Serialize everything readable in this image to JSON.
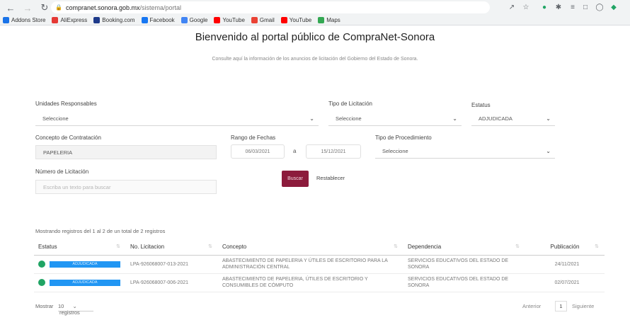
{
  "browser": {
    "url_domain": "compranet.sonora.gob.mx",
    "url_path": "/sistema/portal",
    "bookmarks": [
      {
        "label": "Addons Store",
        "color": "#1a73e8"
      },
      {
        "label": "AliExpress",
        "color": "#e53935"
      },
      {
        "label": "Booking.com",
        "color": "#1e3a8a"
      },
      {
        "label": "Facebook",
        "color": "#1877f2"
      },
      {
        "label": "Google",
        "color": "#4285f4"
      },
      {
        "label": "YouTube",
        "color": "#ff0000"
      },
      {
        "label": "Gmail",
        "color": "#ea4335"
      },
      {
        "label": "YouTube",
        "color": "#ff0000"
      },
      {
        "label": "Maps",
        "color": "#34a853"
      }
    ]
  },
  "page": {
    "title": "Bienvenido al portal público de CompraNet-Sonora",
    "subtitle": "Consulte aquí la información de los anuncios de licitación del Gobierno del Estado de Sonora."
  },
  "filters": {
    "unidades_label": "Unidades Responsables",
    "unidades_value": "Seleccione",
    "tipo_lic_label": "Tipo de Licitación",
    "tipo_lic_value": "Seleccione",
    "estatus_label": "Estatus",
    "estatus_value": "ADJUDICADA",
    "concepto_label": "Concepto de Contratación",
    "concepto_value": "PAPELERIA",
    "rango_label": "Rango de Fechas",
    "fecha_desde": "06/03/2021",
    "fecha_sep": "a",
    "fecha_hasta": "15/12/2021",
    "tipo_proc_label": "Tipo de Procedimiento",
    "tipo_proc_value": "Seleccione",
    "numero_label": "Número de Licitación",
    "numero_placeholder": "Escriba un texto para buscar",
    "buscar_label": "Buscar",
    "reset_label": "Restablecer"
  },
  "results": {
    "count_text": "Mostrando registros del 1 al 2 de un total de 2 registros",
    "columns": [
      "Estatus",
      "No. Licitacion",
      "Concepto",
      "Dependencia",
      "Publicación"
    ],
    "rows": [
      {
        "status": "ADJUDICADA",
        "numero": "LPA-926068007-013-2021",
        "concepto": "ABASTECIMIENTO DE PAPELERIA Y ÚTILES DE ESCRITORIO PARA LA ADMINISTRACIÓN CENTRAL",
        "dependencia": "SERVICIOS EDUCATIVOS DEL ESTADO DE SONORA",
        "publicacion": "24/11/2021"
      },
      {
        "status": "ADJUDICADA",
        "numero": "LPA-926068007-006-2021",
        "concepto": "ABASTECIMIENTO DE PAPELERIA, ÚTILES DE ESCRITORIO Y CONSUMIBLES DE CÓMPUTO",
        "dependencia": "SERVICIOS EDUCATIVOS DEL ESTADO DE SONORA",
        "publicacion": "02/07/2021"
      }
    ],
    "show_label": "Mostrar",
    "show_value": "10",
    "records_label": "registros",
    "prev_label": "Anterior",
    "page_current": "1",
    "next_label": "Siguiente"
  },
  "colors": {
    "accent": "#8c1b3c",
    "status_badge": "#2196f3",
    "status_dot": "#20a464"
  }
}
